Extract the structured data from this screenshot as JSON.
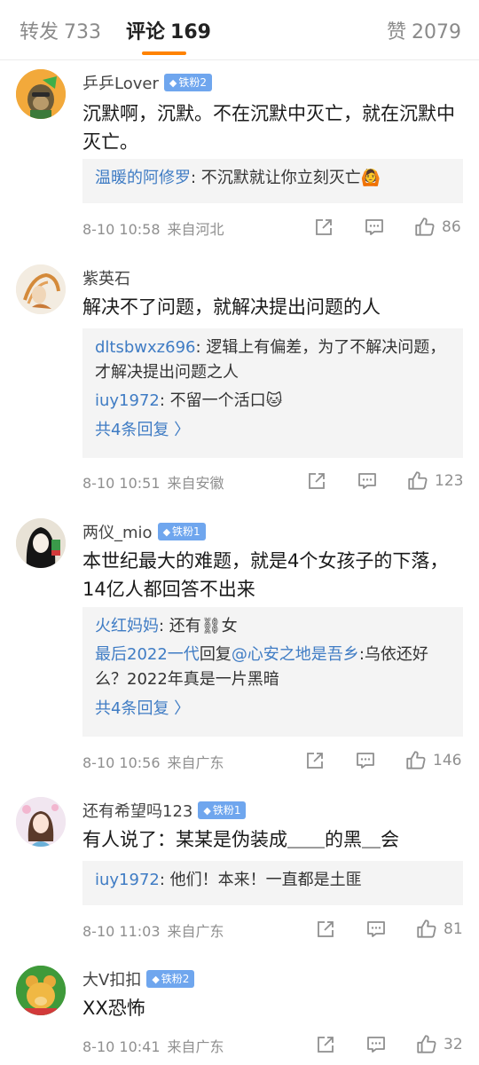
{
  "tabs": {
    "repost_label": "转发",
    "repost_count": "733",
    "comment_label": "评论",
    "comment_count": "169",
    "like_label": "赞",
    "like_count": "2079"
  },
  "colors": {
    "accent": "#ff8200",
    "link": "#3f7cc4",
    "badge": "#6fa6ee"
  },
  "comments": [
    {
      "username": "乒乒Lover",
      "badge": "铁粉2",
      "text": "沉默啊，沉默。不在沉默中灭亡，就在沉默中灭亡。",
      "replies": [
        {
          "name": "温暖的阿修罗",
          "text": ": 不沉默就让你立刻灭亡🙆"
        }
      ],
      "time": "8-10 10:58",
      "source": "来自河北",
      "likes": "86"
    },
    {
      "username": "紫英石",
      "text": "解决不了问题，就解决提出问题的人",
      "replies": [
        {
          "name": "dltsbwxz696",
          "text": ": 逻辑上有偏差，为了不解决问题，才解决提出问题之人"
        },
        {
          "name": "iuy1972",
          "text": ": 不留一个活口🐱"
        }
      ],
      "more": "共4条回复 〉",
      "time": "8-10 10:51",
      "source": "来自安徽",
      "likes": "123"
    },
    {
      "username": "两仪_mio",
      "badge": "铁粉1",
      "text": "本世纪最大的难题，就是4个女孩子的下落，14亿人都回答不出来",
      "replies": [
        {
          "name": "火红妈妈",
          "text": ": 还有⛓女"
        },
        {
          "name": "最后2022一代",
          "reply_word": "回复",
          "mention": "@心安之地是吾乡",
          "text": ":乌依还好么？2022年真是一片黑暗"
        }
      ],
      "more": "共4条回复 〉",
      "time": "8-10 10:56",
      "source": "来自广东",
      "likes": "146"
    },
    {
      "username": "还有希望吗123",
      "badge": "铁粉1",
      "text": "有人说了：某某是伪装成＿＿的黑＿会",
      "replies": [
        {
          "name": "iuy1972",
          "text": ": 他们！本来！一直都是土匪"
        }
      ],
      "time": "8-10 11:03",
      "source": "来自广东",
      "likes": "81"
    },
    {
      "username": "大V扣扣",
      "badge": "铁粉2",
      "text": "XX恐怖",
      "time": "8-10 10:41",
      "source": "来自广东",
      "likes": "32"
    }
  ]
}
